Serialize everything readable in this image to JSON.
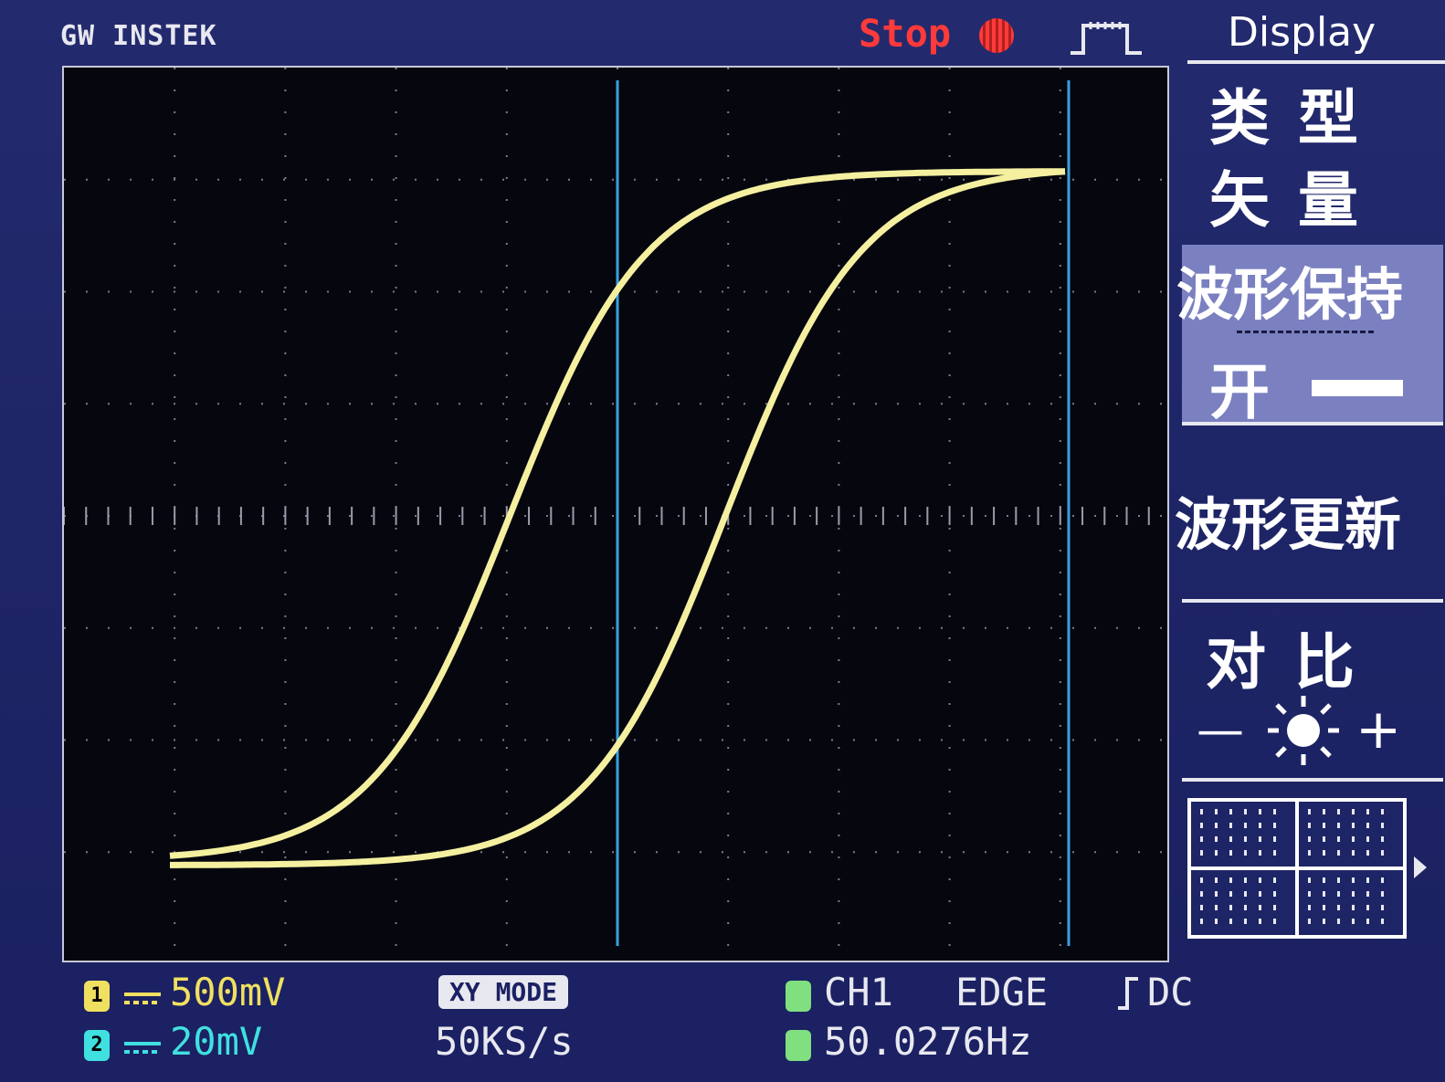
{
  "brand": "GW INSTEK",
  "run_status": "Stop",
  "menu": {
    "title": "Display",
    "type_label": "类  型",
    "type_value": "矢  量",
    "hold_label": "波形保持",
    "hold_value": "开",
    "refresh_label": "波形更新",
    "contrast_label": "对  比",
    "contrast_minus": "—",
    "contrast_plus": "+"
  },
  "bottom": {
    "ch1_num": "1",
    "ch1_scale": "500mV",
    "ch2_num": "2",
    "ch2_scale": "20mV",
    "mode": "XY MODE",
    "sample_rate": "50KS/s",
    "trigger_source": "CH1",
    "trigger_type": "EDGE",
    "coupling": "DC",
    "frequency": "50.0276Hz"
  },
  "colors": {
    "trace": "#f4f0a0",
    "cursor": "#3aa0e0",
    "status": "#ff3a3a",
    "ch1": "#f0e060",
    "ch2": "#40e0e0",
    "trig": "#80e080"
  },
  "icons": [
    "stop-dot-icon",
    "trigger-pulse-icon",
    "brightness-sun-icon",
    "grid-icon",
    "menu-arrow-icon"
  ]
}
